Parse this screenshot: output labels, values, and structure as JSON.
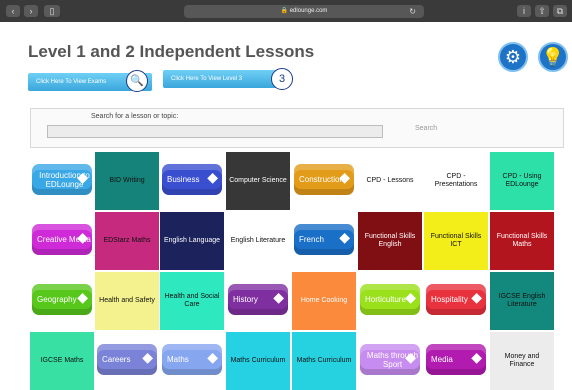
{
  "browser": {
    "url": "edlounge.com"
  },
  "page": {
    "title": "Level 1 and 2 Independent Lessons"
  },
  "actions": {
    "exams_label": "Click Here To View Exams",
    "level3_label": "Click Here To View Level 3",
    "level3_badge": "3"
  },
  "search": {
    "label": "Search for a lesson or topic:",
    "placeholder": "",
    "button": "Search"
  },
  "icons": {
    "settings": "gear-icon",
    "help": "lightbulb-icon",
    "exams": "magnifier-people-icon"
  },
  "tiles": [
    {
      "label": "Introduction to EDLounge",
      "style": "button",
      "color": "#3aa7e6"
    },
    {
      "label": "BID Writing",
      "style": "plain",
      "color": "#16837a",
      "text": "#111111"
    },
    {
      "label": "Business",
      "style": "button",
      "color": "#3a4fd0"
    },
    {
      "label": "Computer Science",
      "style": "plain",
      "color": "#373737",
      "text": "#ffffff"
    },
    {
      "label": "Construction",
      "style": "button",
      "color": "#e39b1a"
    },
    {
      "label": "CPD - Lessons",
      "style": "plain",
      "color": "#ffffff",
      "text": "#111111"
    },
    {
      "label": "CPD - Presentations",
      "style": "plain",
      "color": "#ffffff",
      "text": "#111111"
    },
    {
      "label": "CPD - Using EDLounge",
      "style": "plain",
      "color": "#2de0a8",
      "text": "#111111"
    },
    {
      "label": "Creative Media",
      "style": "button",
      "color": "#cf2ad8"
    },
    {
      "label": "EDStarz Maths",
      "style": "plain",
      "color": "#c52a7e",
      "text": "#111111"
    },
    {
      "label": "English Language",
      "style": "plain",
      "color": "#1c225b",
      "text": "#ffffff"
    },
    {
      "label": "English Literature",
      "style": "plain",
      "color": "#ffffff",
      "text": "#111111"
    },
    {
      "label": "French",
      "style": "button",
      "color": "#1a6fc7"
    },
    {
      "label": "Functional Skills English",
      "style": "plain",
      "color": "#800f13",
      "text": "#ffffff"
    },
    {
      "label": "Functional Skills ICT",
      "style": "plain",
      "color": "#f3ee1a",
      "text": "#111111"
    },
    {
      "label": "Functional Skills Maths",
      "style": "plain",
      "color": "#b3151e",
      "text": "#ffffff"
    },
    {
      "label": "Geography",
      "style": "button",
      "color": "#58c71c"
    },
    {
      "label": "Health and Safety",
      "style": "plain",
      "color": "#f3f28e",
      "text": "#111111"
    },
    {
      "label": "Health and Social Care",
      "style": "plain",
      "color": "#2ee8c0",
      "text": "#111111"
    },
    {
      "label": "History",
      "style": "button",
      "color": "#802fa0"
    },
    {
      "label": "Home Cooking",
      "style": "plain",
      "color": "#fb8a3d",
      "text": "#ffffff"
    },
    {
      "label": "Horticulture",
      "style": "button",
      "color": "#9ae01b"
    },
    {
      "label": "Hospitality",
      "style": "button",
      "color": "#e8323e"
    },
    {
      "label": "IGCSE English Literature",
      "style": "plain",
      "color": "#13887c",
      "text": "#111111"
    },
    {
      "label": "IGCSE Maths",
      "style": "plain",
      "color": "#39e0a4",
      "text": "#111111"
    },
    {
      "label": "Careers",
      "style": "button",
      "color": "#7b83d8"
    },
    {
      "label": "Maths",
      "style": "button",
      "color": "#86a6f0"
    },
    {
      "label": "Maths Curriculum",
      "style": "plain",
      "color": "#25d1e2",
      "text": "#111111"
    },
    {
      "label": "Maths Curriculum",
      "style": "plain",
      "color": "#26d2e0",
      "text": "#111111"
    },
    {
      "label": "Maths through Sport",
      "style": "button",
      "color": "#c78cf0"
    },
    {
      "label": "Media",
      "style": "button",
      "color": "#b21bb0"
    },
    {
      "label": "Money and Finance",
      "style": "plain",
      "color": "#ececec",
      "text": "#111111"
    }
  ]
}
